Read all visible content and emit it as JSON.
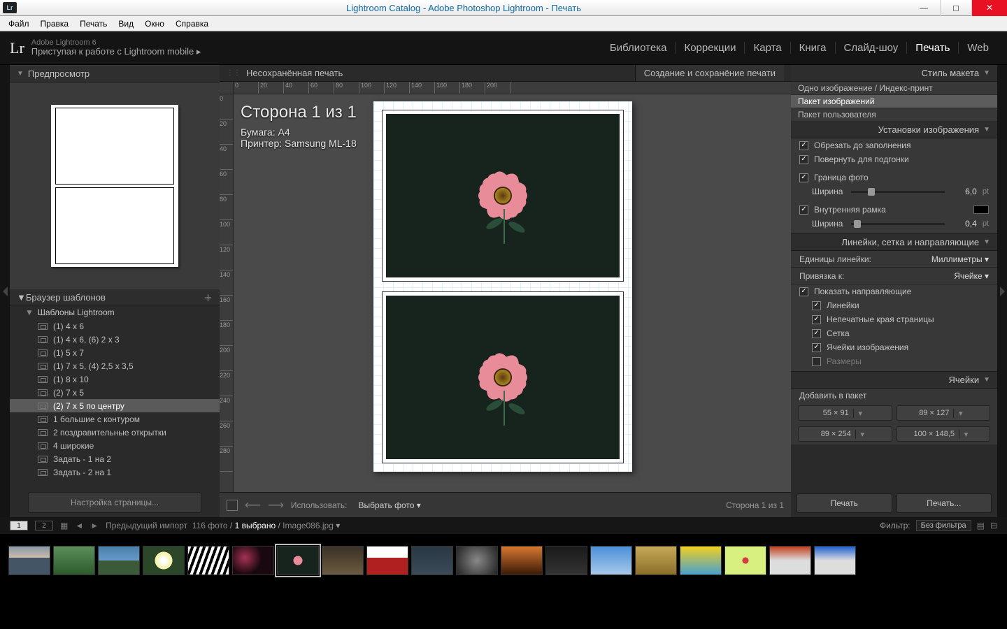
{
  "window": {
    "title": "Lightroom Catalog - Adobe Photoshop Lightroom - Печать"
  },
  "menu": [
    "Файл",
    "Правка",
    "Печать",
    "Вид",
    "Окно",
    "Справка"
  ],
  "header": {
    "logo": "Lr",
    "sub": "Adobe Lightroom 6",
    "main": "Приступая к работе с Lightroom mobile  ▸",
    "modules": [
      "Библиотека",
      "Коррекции",
      "Карта",
      "Книга",
      "Слайд-шоу",
      "Печать",
      "Web"
    ],
    "active_module": "Печать"
  },
  "left": {
    "preview_title": "Предпросмотр",
    "tmpl_title": "Браузер шаблонов",
    "tmpl_group": "Шаблоны Lightroom",
    "templates": [
      "(1) 4 x 6",
      "(1) 4 x 6, (6) 2 x 3",
      "(1) 5 x 7",
      "(1) 7 x 5, (4) 2,5 x 3,5",
      "(1) 8 x 10",
      "(2) 7 x 5",
      "(2) 7 x 5 по центру",
      "1 большие с контуром",
      "2 поздравительные открытки",
      "4 широкие",
      "Задать - 1 на 2",
      "Задать - 2 на 1"
    ],
    "selected_idx": 6,
    "page_setup": "Настройка страницы..."
  },
  "center": {
    "unsaved": "Несохранённая печать",
    "create_save": "Создание и сохранёние печати",
    "page_info": "Сторона 1 из 1",
    "paper": "Бумага:  A4",
    "printer": "Принтер:  Samsung ML-18",
    "use_label": "Использовать:",
    "use_value": "Выбрать фото ▾",
    "page_of": "Сторона 1 из 1"
  },
  "right": {
    "style_title": "Стиль макета",
    "style_opts": [
      "Одно изображение / Индекс-принт",
      "Пакет изображений",
      "Пакет пользователя"
    ],
    "style_sel": 1,
    "img_settings": "Установки изображения",
    "crop_fill": "Обрезать до заполнения",
    "rotate_fit": "Повернуть для подгонки",
    "photo_border": "Граница фото",
    "width_label": "Ширина",
    "border_val": "6,0",
    "pt": "pt",
    "inner_frame": "Внутренняя рамка",
    "inner_val": "0,4",
    "guides_title": "Линейки, сетка и направляющие",
    "ruler_units": "Единицы линейки:",
    "ruler_units_val": "Миллиметры ▾",
    "snap": "Привязка к:",
    "snap_val": "Ячейке ▾",
    "show_guides": "Показать направляющие",
    "g_rulers": "Линейки",
    "g_nonprint": "Непечатные края страницы",
    "g_grid": "Сетка",
    "g_cells": "Ячейки изображения",
    "g_dims": "Размеры",
    "cells_title": "Ячейки",
    "add_pkg": "Добавить в пакет",
    "sizes": [
      "55 × 91",
      "89 × 127",
      "89 × 254",
      "100 × 148,5"
    ],
    "print": "Печать",
    "print_dlg": "Печать..."
  },
  "film": {
    "pg1": "1",
    "pg2": "2",
    "prev_import": "Предыдущий импорт",
    "count": "116 фото",
    "sel": "1 выбрано",
    "fname": "Image086.jpg",
    "filter_label": "Фильтр:",
    "filter_val": "Без фильтра"
  },
  "thumbs": [
    "linear-gradient(#89a, #cba 40%, #456 40%)",
    "linear-gradient(#5a8f5a,#2c5a2c)",
    "linear-gradient(#4a7fa8,#6699cc 50%,#3a5a3a 50%)",
    "radial-gradient(circle at 50% 50%, #fff 8%, #f5f0a0 35%, #2b4628 36%)",
    "repeating-linear-gradient(110deg,#fff 0 4px,#000 4px 8px)",
    "radial-gradient(circle at 30% 40%, #a03050 2%, #1a0810 50%)",
    "radial-gradient(circle at 50% 50%, #e98c9a 18%, #17231d 19%)",
    "linear-gradient(#3a3228,#6b5a40)",
    "linear-gradient(#fff 40%,#b02020 40%)",
    "linear-gradient(#2a3844,#3a4a58)",
    "radial-gradient(circle,#888,#222)",
    "linear-gradient(#d97830,#3a1a08)",
    "linear-gradient(#1a1a1a,#333)",
    "linear-gradient(#4a90d9,#a8c8e8)",
    "linear-gradient(#c8a858,#8b6f2a)",
    "linear-gradient(#f0d020,#4aa0d0)",
    "radial-gradient(circle at 50% 50%,#d04040 12%, #d8f080 14%)",
    "linear-gradient(#c04020,#ddd 50%)",
    "linear-gradient(#2060d0,#ddd 50%)"
  ],
  "thumb_sel": 6
}
